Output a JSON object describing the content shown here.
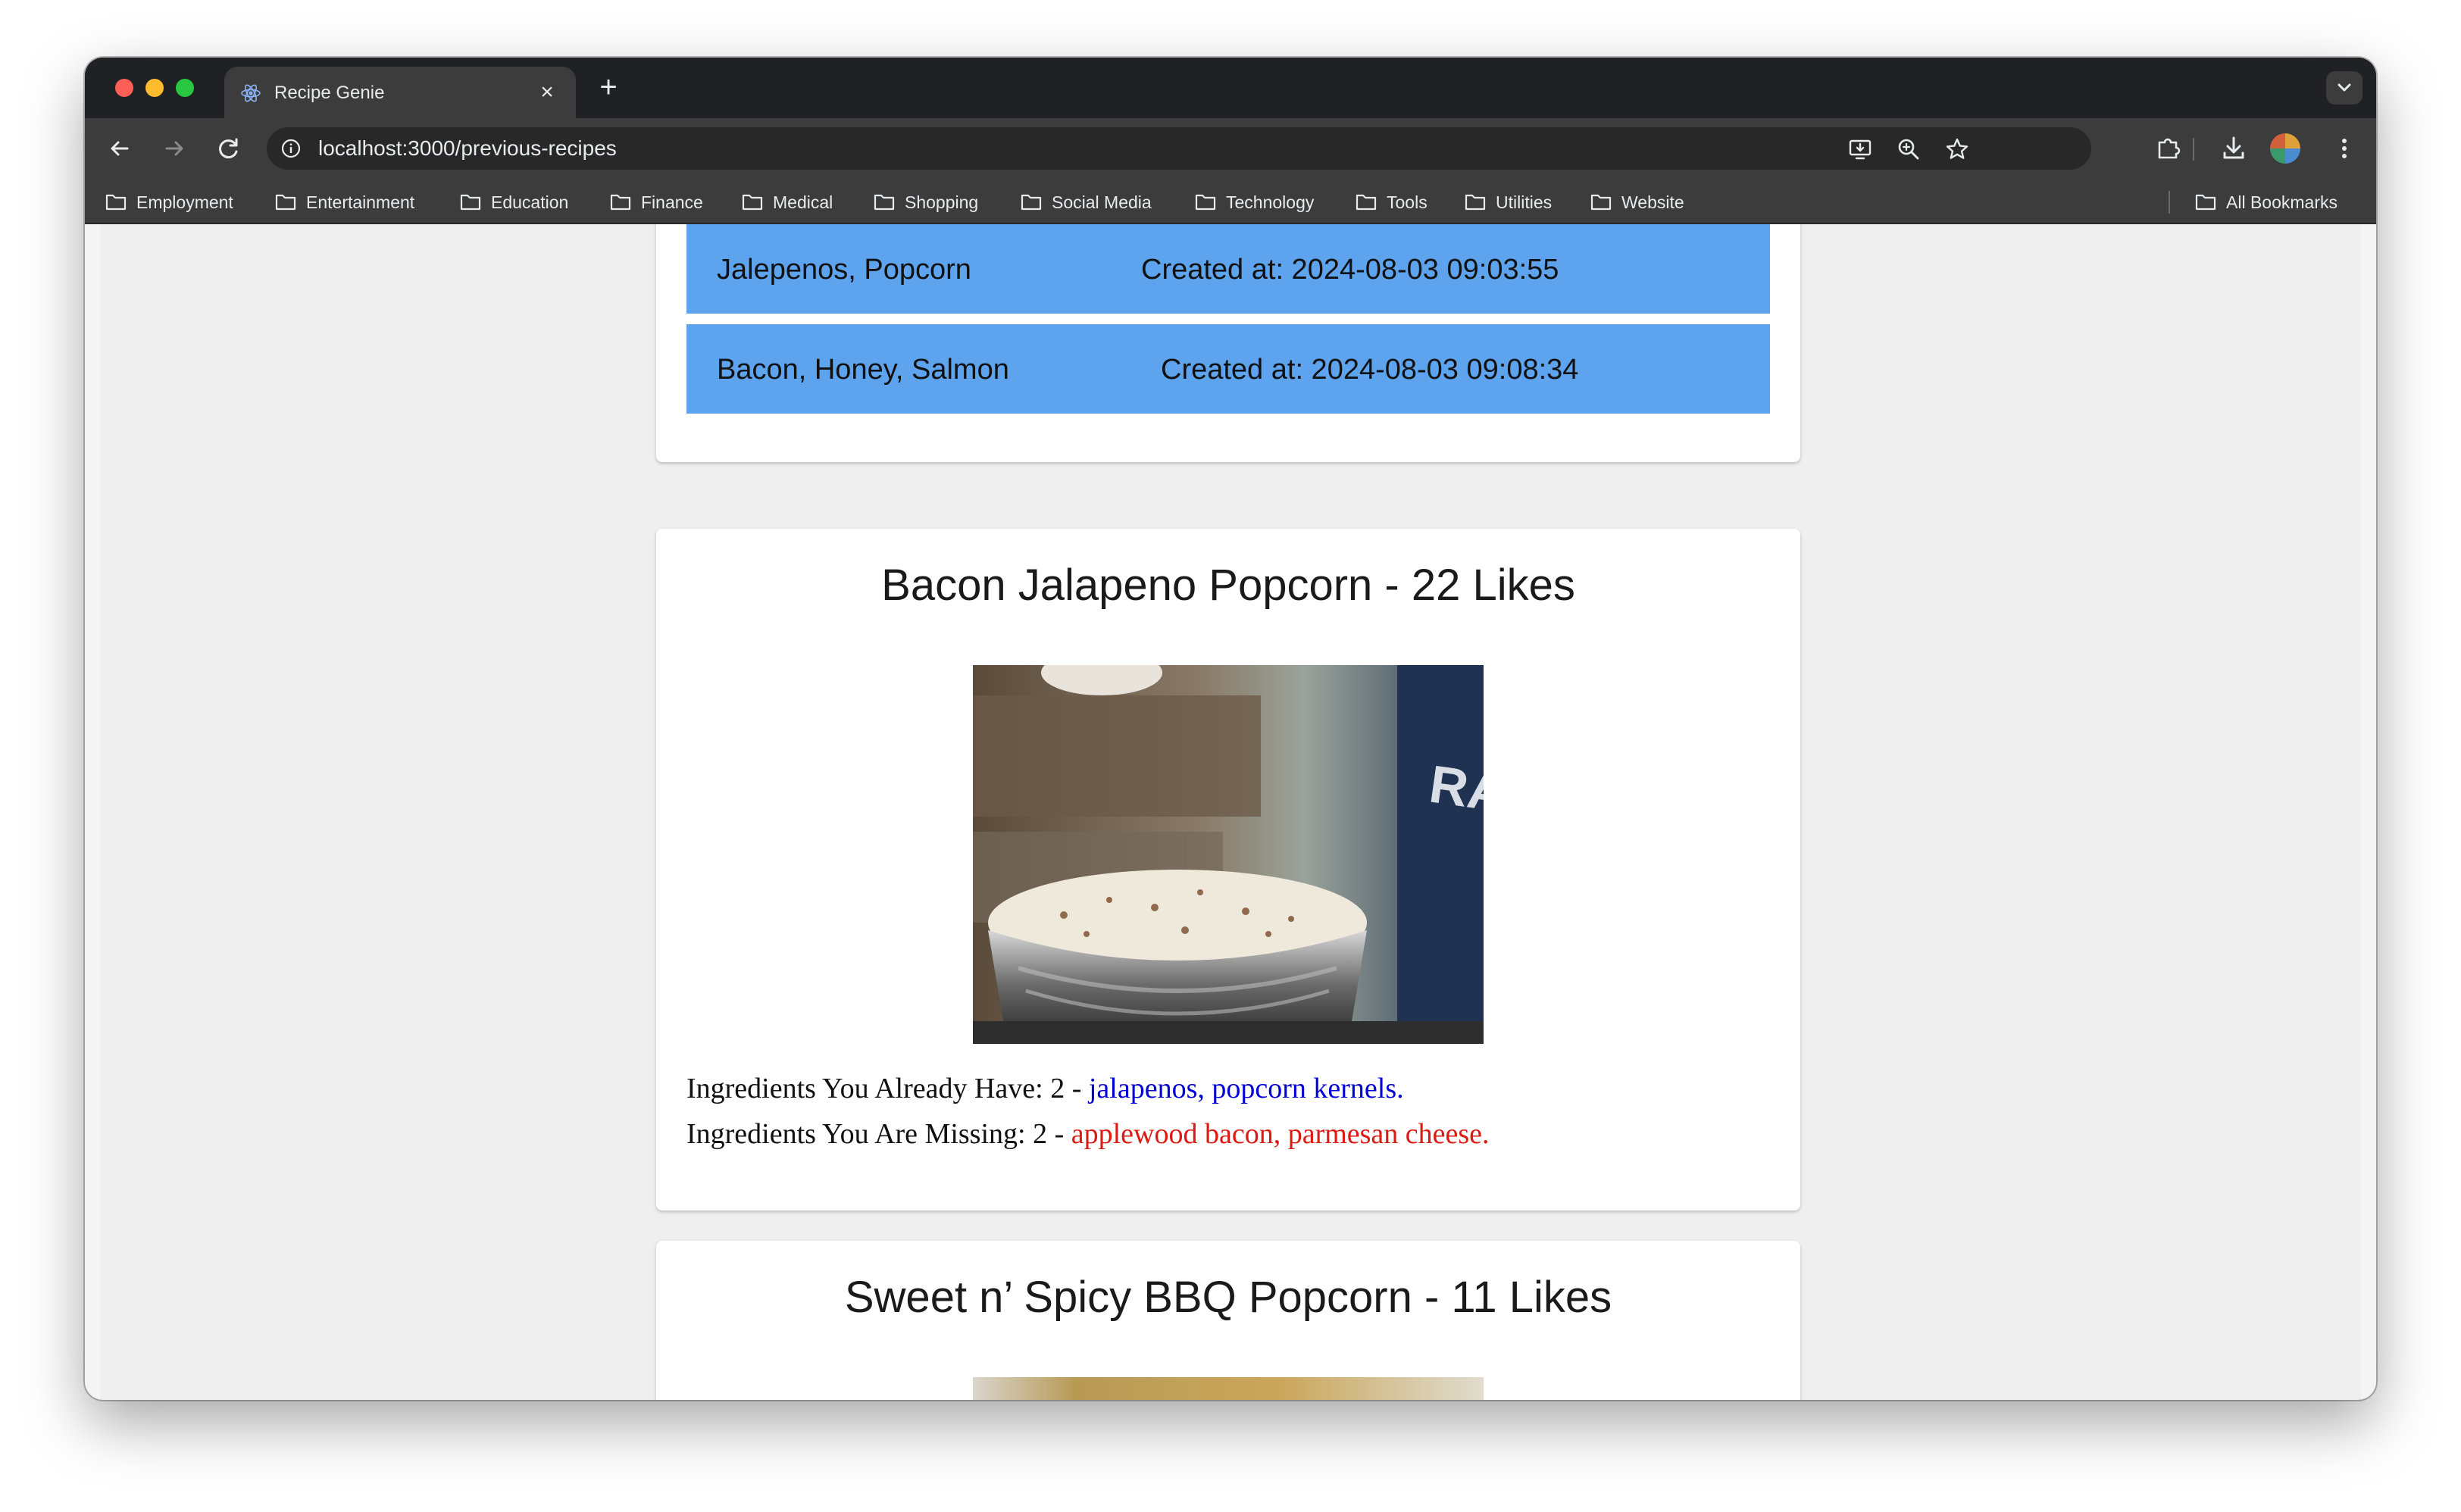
{
  "browser": {
    "tab_title": "Recipe Genie",
    "tab_close": "×",
    "new_tab": "+",
    "url_host": "localhost",
    "url_rest": ":3000/previous-recipes",
    "window_colors": {
      "red": "#ff5f57",
      "yellow": "#febc2e",
      "green": "#28c840"
    }
  },
  "bookmarks": {
    "items": [
      "Employment",
      "Entertainment",
      "Education",
      "Finance",
      "Medical",
      "Shopping",
      "Social Media",
      "Technology",
      "Tools",
      "Utilities",
      "Website"
    ],
    "all": "All Bookmarks"
  },
  "history": [
    {
      "ingredients": "Jalepenos, Popcorn",
      "created": "Created at: 2024-08-03 09:03:55"
    },
    {
      "ingredients": "Bacon, Honey, Salmon",
      "created": "Created at: 2024-08-03 09:08:34"
    }
  ],
  "recipe": {
    "title": "Bacon Jalapeno Popcorn - 22 Likes",
    "have_label": "Ingredients You Already Have: 2 - ",
    "have_items": "jalapenos, popcorn kernels.",
    "missing_label": "Ingredients You Are Missing: 2 - ",
    "missing_items": "applewood bacon, parmesan cheese."
  },
  "next_recipe": {
    "title": "Sweet n’ Spicy BBQ Popcorn - 11 Likes"
  },
  "colors": {
    "history_row": "#5da3ee",
    "have": "#0000d6",
    "missing": "#dd1a12"
  }
}
